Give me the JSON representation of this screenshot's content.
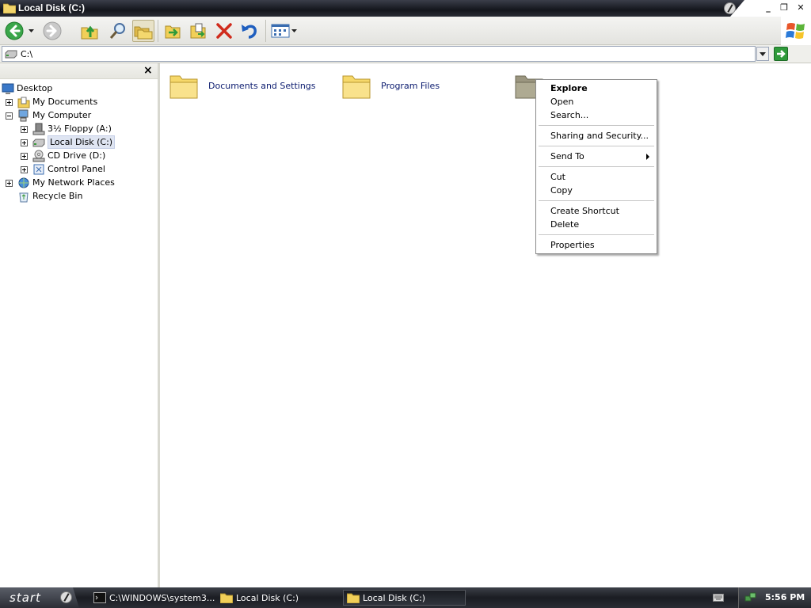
{
  "window": {
    "title": "Local Disk (C:)",
    "minimize_label": "_",
    "restore_label": "❐",
    "close_label": "✕"
  },
  "toolbar": {
    "buttons": [
      "back-icon",
      "forward-icon",
      "up-icon",
      "search-icon",
      "folders-icon",
      "move-to-icon",
      "copy-to-icon",
      "delete-icon",
      "undo-icon",
      "views-icon"
    ],
    "accent_colors": {
      "back": "#3aa64a",
      "delete": "#d02b1c",
      "undo": "#1f5fbf",
      "go": "#2f9a3a"
    }
  },
  "address": {
    "value": "C:\\"
  },
  "folder_pane": {
    "close_label": "×",
    "tree": [
      {
        "label": "Desktop",
        "icon": "desktop-icon"
      },
      {
        "label": "My Documents",
        "icon": "my-documents-icon"
      },
      {
        "label": "My Computer",
        "icon": "my-computer-icon"
      },
      {
        "label": "3½ Floppy (A:)",
        "icon": "floppy-icon"
      },
      {
        "label": "Local Disk (C:)",
        "icon": "drive-icon",
        "selected": true
      },
      {
        "label": "CD Drive (D:)",
        "icon": "cd-drive-icon"
      },
      {
        "label": "Control Panel",
        "icon": "control-panel-icon"
      },
      {
        "label": "My Network Places",
        "icon": "network-icon"
      },
      {
        "label": "Recycle Bin",
        "icon": "recycle-bin-icon"
      }
    ]
  },
  "main": {
    "folders": [
      {
        "label": "Documents and Settings"
      },
      {
        "label": "Program Files"
      },
      {
        "label": ""
      }
    ]
  },
  "context_menu": {
    "items": [
      {
        "label": "Explore"
      },
      {
        "label": "Open"
      },
      {
        "label": "Search..."
      },
      {
        "label": "Sharing and Security..."
      },
      {
        "label": "Send To"
      },
      {
        "label": "Cut"
      },
      {
        "label": "Copy"
      },
      {
        "label": "Create Shortcut"
      },
      {
        "label": "Delete"
      },
      {
        "label": "Properties"
      }
    ]
  },
  "taskbar": {
    "start_label": "start",
    "tasks": [
      {
        "label": "C:\\WINDOWS\\system3..."
      },
      {
        "label": "Local Disk (C:)"
      },
      {
        "label": "Local Disk (C:)"
      }
    ],
    "clock": "5:56 PM"
  }
}
